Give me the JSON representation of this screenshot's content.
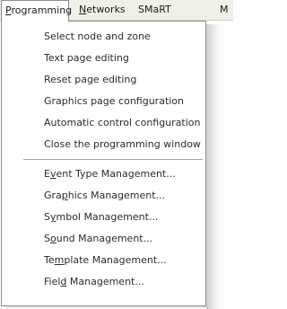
{
  "menubar": {
    "items": [
      {
        "pre": "",
        "underlined": "P",
        "post": "rogramming"
      },
      {
        "pre": "",
        "underlined": "N",
        "post": "etworks"
      },
      {
        "pre": "",
        "underlined": "",
        "post": "SMaRT"
      },
      {
        "pre": "",
        "underlined": "",
        "post": "M"
      }
    ]
  },
  "dropdown": {
    "group1": [
      {
        "pre": "Select node and zone",
        "underlined": "",
        "post": ""
      },
      {
        "pre": "Text page editing",
        "underlined": "",
        "post": ""
      },
      {
        "pre": "Reset page editing",
        "underlined": "",
        "post": ""
      },
      {
        "pre": "Graphics page configuration",
        "underlined": "",
        "post": ""
      },
      {
        "pre": "Automatic control configuration",
        "underlined": "",
        "post": ""
      },
      {
        "pre": "Close the programming window",
        "underlined": "",
        "post": ""
      }
    ],
    "group2": [
      {
        "pre": "E",
        "underlined": "v",
        "post": "ent Type Management..."
      },
      {
        "pre": "Gra",
        "underlined": "p",
        "post": "hics Management..."
      },
      {
        "pre": "S",
        "underlined": "y",
        "post": "mbol Management..."
      },
      {
        "pre": "S",
        "underlined": "o",
        "post": "und Management..."
      },
      {
        "pre": "Te",
        "underlined": "m",
        "post": "plate Management..."
      },
      {
        "pre": "Fiel",
        "underlined": "d",
        "post": " Management..."
      }
    ]
  }
}
